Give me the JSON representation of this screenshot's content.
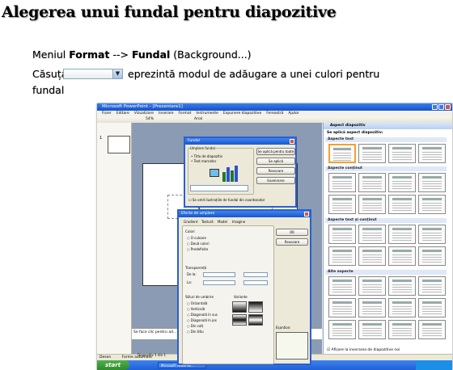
{
  "heading": "Alegerea unui fundal pentru diapozitive",
  "line1": {
    "prefix": "Meniul ",
    "menu": "Format",
    "arrow": " --> ",
    "item": "Fundal",
    "suffix": " (Background...)"
  },
  "line2": {
    "prefix": "Căsuța",
    "text": "eprezintă modul de adăugare a unei culori pentru"
  },
  "line3": "fundal",
  "combo_arrow_icon": "dropdown-arrow",
  "screenshot": {
    "window_title": "Microsoft PowerPoint - [Prezentare1]",
    "menus": [
      "Fișier",
      "Editare",
      "Vizualizare",
      "Inserare",
      "Format",
      "Instrumente",
      "Expunere diapozitive",
      "Fereastră",
      "Ajutor"
    ],
    "zoom": "54%",
    "font": "Arial",
    "slide_number": "1",
    "slide_placeholder": "S",
    "notes_text": "Se face clic pentru ad...",
    "draw_label": "Desen",
    "autoshapes_label": "Forme automate",
    "status_text": "Diapozitiv 1 din 1",
    "start_label": "start",
    "task_label": "Microsoft PowerPoi...",
    "tray_time": "",
    "taskpane": {
      "title": "Aspect diapozitiv",
      "apply_label": "Se aplică aspect diapozitiv:",
      "sections": [
        "Aspecte text",
        "Aspecte conținut",
        "Aspecte text și conținut",
        "Alte aspecte"
      ],
      "footer": "Afișare la inserarea de diapozitive noi"
    },
    "fundal_dialog": {
      "title": "Fundal",
      "group_label": "Umplere fundal",
      "option1": "Titlu de diapozitiv",
      "option2": "Text marcator",
      "btn_apply_all": "Se aplică pentru toate",
      "btn_apply": "Se aplică",
      "btn_cancel": "Revocare",
      "btn_preview": "Examinare",
      "checkbox": "Se omit ilustrațiile de fundal din coordonator"
    },
    "effects_dialog": {
      "title": "Efecte de umplere",
      "tabs": [
        "Gradient",
        "Textură",
        "Model",
        "Imagine"
      ],
      "colors_label": "Culori",
      "color_opts": [
        "O culoare",
        "Două culori",
        "Predefinite"
      ],
      "transparency_label": "Transparență",
      "from_label": "De la:",
      "to_label": "La:",
      "shading_label": "Stiluri de umbrire",
      "shading_opts": [
        "Orizontală",
        "Verticală",
        "Diagonală în sus",
        "Diagonală în jos",
        "Din colț",
        "Din titlu"
      ],
      "variants_label": "Variante",
      "btn_ok": "OK",
      "btn_cancel": "Revocare",
      "sample_label": "Eșantion:"
    }
  }
}
